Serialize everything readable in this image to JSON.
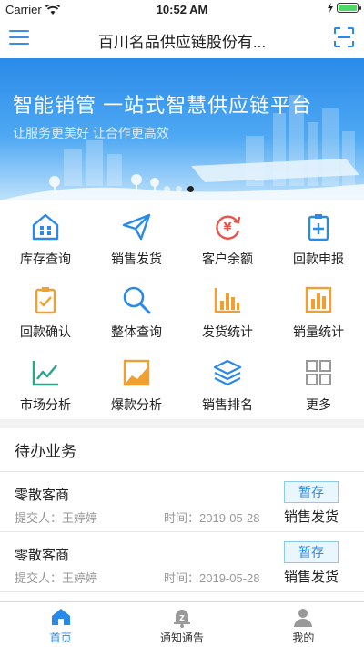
{
  "status_bar": {
    "carrier": "Carrier",
    "time": "10:52 AM"
  },
  "nav": {
    "title": "百川名品供应链股份有...",
    "menu_icon": "menu-icon",
    "scan_icon": "scan-icon"
  },
  "banner": {
    "title": "智能销管  一站式智慧供应链平台",
    "subtitle": "让服务更美好 让合作更高效",
    "page_count": 3,
    "active_page": 3
  },
  "menu": [
    {
      "label": "库存查询",
      "icon": "warehouse-icon",
      "color": "#2a8ae8"
    },
    {
      "label": "销售发货",
      "icon": "paper-plane-icon",
      "color": "#2a8ae8"
    },
    {
      "label": "客户余额",
      "icon": "yuan-cycle-icon",
      "color": "#e8534a"
    },
    {
      "label": "回款申报",
      "icon": "clipboard-plus-icon",
      "color": "#2a8ae8"
    },
    {
      "label": "回款确认",
      "icon": "clipboard-check-icon",
      "color": "#f0a030"
    },
    {
      "label": "整体查询",
      "icon": "magnifier-icon",
      "color": "#2a8ae8"
    },
    {
      "label": "发货统计",
      "icon": "bar-chart-icon",
      "color": "#f0a030"
    },
    {
      "label": "销量统计",
      "icon": "bar-chart-filled-icon",
      "color": "#f0a030"
    },
    {
      "label": "市场分析",
      "icon": "line-chart-icon",
      "color": "#2aa58a"
    },
    {
      "label": "爆款分析",
      "icon": "trend-chart-icon",
      "color": "#f0a030"
    },
    {
      "label": "销售排名",
      "icon": "layers-icon",
      "color": "#2a8ae8"
    },
    {
      "label": "更多",
      "icon": "grid-more-icon",
      "color": "#999999"
    }
  ],
  "todo": {
    "title": "待办业务",
    "items": [
      {
        "name": "零散客商",
        "submitter": "提交人：王婷婷",
        "time": "时间：2019-05-28",
        "status": "暂存",
        "type": "销售发货"
      },
      {
        "name": "零散客商",
        "submitter": "提交人：王婷婷",
        "time": "时间：2019-05-28",
        "status": "暂存",
        "type": "销售发货"
      }
    ]
  },
  "tabs": [
    {
      "label": "首页",
      "icon": "home-icon",
      "active": true
    },
    {
      "label": "通知通告",
      "icon": "notification-icon",
      "active": false
    },
    {
      "label": "我的",
      "icon": "person-icon",
      "active": false
    }
  ],
  "colors": {
    "accent": "#2a8ae8",
    "badge_bg": "#eaf6fd",
    "badge_border": "#8cc9ee"
  }
}
